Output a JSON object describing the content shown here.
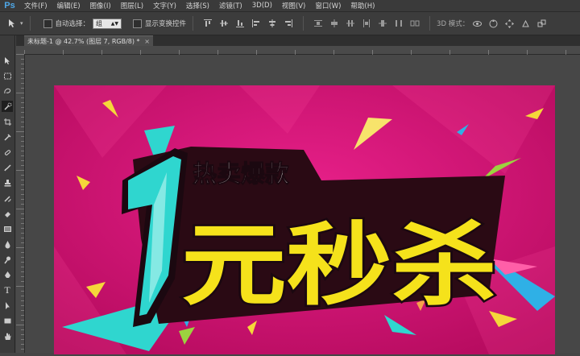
{
  "app": {
    "logo": "Ps",
    "accent": "#4fa8e8"
  },
  "menu": [
    "文件(F)",
    "编辑(E)",
    "图像(I)",
    "图层(L)",
    "文字(Y)",
    "选择(S)",
    "滤镜(T)",
    "3D(D)",
    "视图(V)",
    "窗口(W)",
    "帮助(H)"
  ],
  "options": {
    "auto_select_label": "自动选择：",
    "auto_select_value": "组",
    "show_transform_label": "显示变换控件",
    "mode_3d_label": "3D 模式："
  },
  "document": {
    "tab_title": "未标题-1 @ 42.7% (图层 7, RGB/8) *",
    "close": "×"
  },
  "artwork": {
    "line1": "热卖爆款",
    "line2": "元秒杀",
    "numeral": "1",
    "bg_color": "#d4136e",
    "title_color": "#f5e21b",
    "numeral_color": "#2fd6cf"
  }
}
